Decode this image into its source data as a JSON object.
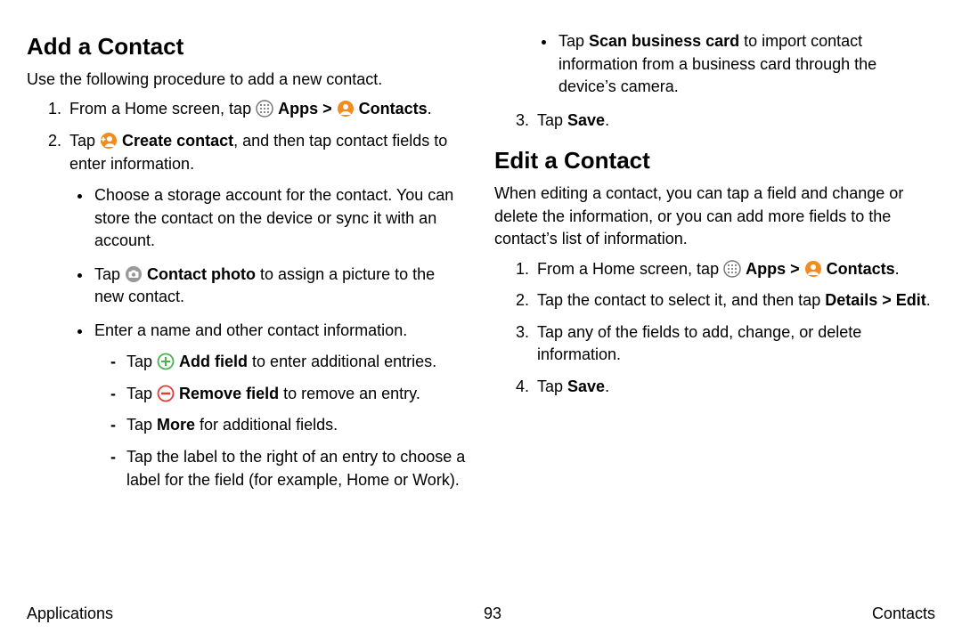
{
  "footer": {
    "left": "Applications",
    "center": "93",
    "right": "Contacts"
  },
  "left": {
    "heading": "Add a Contact",
    "intro": "Use the following procedure to add a new contact.",
    "steps": {
      "s1": {
        "prefix": "From a Home screen, tap ",
        "apps": "Apps",
        "sep": " > ",
        "contacts": "Contacts",
        "end": "."
      },
      "s2": {
        "prefix": "Tap ",
        "create": "Create contact",
        "rest": ", and then tap contact fields to enter information."
      }
    },
    "bullets": {
      "b1": "Choose a storage account for the contact. You can store the contact on the device or sync it with an account.",
      "b2_prefix": "Tap ",
      "b2_bold": "Contact photo",
      "b2_rest": " to assign a picture to the new contact.",
      "b3": "Enter a name and other contact information."
    },
    "dashes": {
      "d1_prefix": "Tap ",
      "d1_bold": "Add field",
      "d1_rest": " to enter additional entries.",
      "d2_prefix": "Tap ",
      "d2_bold": "Remove field",
      "d2_rest": " to remove an entry.",
      "d3_prefix": "Tap ",
      "d3_bold": "More",
      "d3_rest": " for additional fields.",
      "d4": "Tap the label to the right of an entry to choose a label for the field (for example, Home or Work)."
    }
  },
  "right": {
    "top_bullet_prefix": "Tap ",
    "top_bullet_bold": "Scan business card",
    "top_bullet_rest": " to import contact information from a business card through the device’s camera.",
    "step3_prefix": "Tap ",
    "step3_bold": "Save",
    "step3_end": ".",
    "heading2": "Edit a Contact",
    "intro2": "When editing a contact, you can tap a field and change or delete the information, or you can add more fields to the contact’s list of information.",
    "edit_steps": {
      "s1": {
        "prefix": "From a Home screen, tap ",
        "apps": "Apps",
        "sep": " > ",
        "contacts": "Contacts",
        "end": "."
      },
      "s2_prefix": "Tap the contact to select it, and then tap ",
      "s2_bold": "Details > Edit",
      "s2_end": ".",
      "s3": "Tap any of the fields to add, change, or delete information.",
      "s4_prefix": "Tap ",
      "s4_bold": "Save",
      "s4_end": "."
    }
  }
}
